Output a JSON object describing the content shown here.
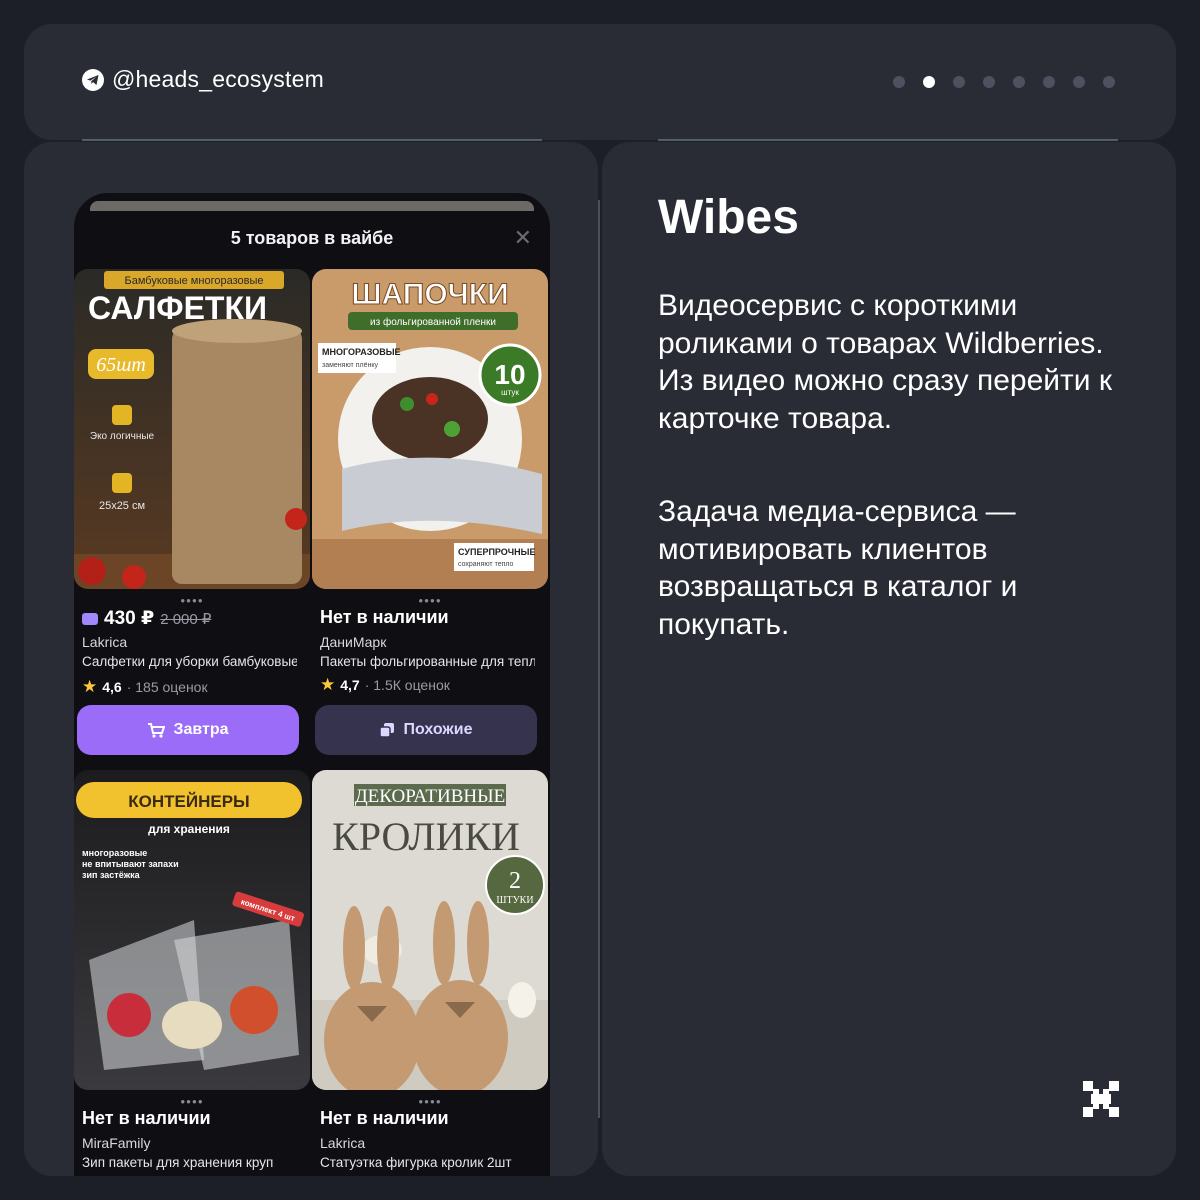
{
  "header": {
    "handle": "@heads_ecosystem",
    "icon": "telegram-icon",
    "pager": {
      "total": 8,
      "active": 2
    }
  },
  "sheet": {
    "title": "5 товаров в вайбе",
    "close_icon": "close-icon"
  },
  "products": [
    {
      "image_heading": "САЛФЕТКИ",
      "image_tag": "Бамбуковые   многоразовые",
      "image_badge": "65шт",
      "image_note1": "Эко логичные",
      "image_note2": "25x25 см",
      "price": "430 ₽",
      "old_price": "2 000 ₽",
      "brand": "Lakrica",
      "name": "Салфетки для уборки бамбуковые",
      "rating": "4,6",
      "reviews": "· 185 оценок",
      "button": "Завтра",
      "button_icon": "cart-icon"
    },
    {
      "image_heading": "ШАПОЧКИ",
      "image_tag": "из фольгированной пленки",
      "image_note1": "МНОГОРАЗОВЫЕ",
      "image_note1_sub": "заменяют плёнку",
      "image_badge": "10",
      "image_badge_sub": "штук",
      "image_note2": "СУПЕРПРОЧНЫЕ",
      "image_note2_sub": "сохраняют тепло",
      "status": "Нет в наличии",
      "brand": "ДаниМарк",
      "name": "Пакеты фольгированные для тепла",
      "rating": "4,7",
      "reviews": "· 1.5К оценок",
      "button": "Похожие",
      "button_icon": "similar-icon"
    },
    {
      "image_heading": "КОНТЕЙНЕРЫ",
      "image_sub": "для хранения",
      "image_bullets": [
        "многоразовые",
        "не впитывают запахи",
        "зип застёжка"
      ],
      "image_tag": "комплект 4 шт",
      "status": "Нет в наличии",
      "brand": "MiraFamily",
      "name": "Зип пакеты для хранения круп"
    },
    {
      "image_tag": "ДЕКОРАТИВНЫЕ",
      "image_heading": "КРОЛИКИ",
      "image_badge": "2",
      "image_badge_sub": "ШТУКИ",
      "status": "Нет в наличии",
      "brand": "Lakrica",
      "name": "Статуэтка фигурка кролик 2шт"
    }
  ],
  "right": {
    "title": "Wibes",
    "paragraph1": "Видеосервис с короткими роликами о товарах Wildberries. Из видео можно сразу перейти к карточке товара.",
    "paragraph2": "Задача медиа-сервиса — мотивировать клиентов возвращаться в каталог и покупать.",
    "logo_icon": "heads-logo-icon"
  },
  "colors": {
    "background": "#1d1f28",
    "panel": "#292b35",
    "accent_purple": "#9b6cf8",
    "star": "#ffc83a"
  }
}
